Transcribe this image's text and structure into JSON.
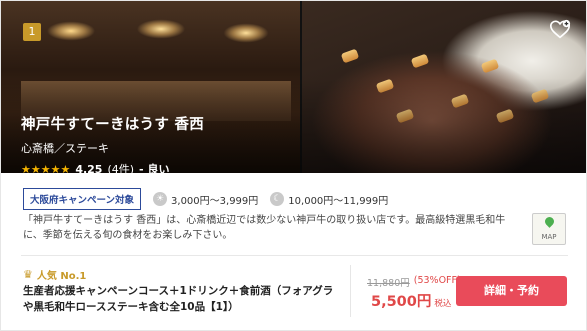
{
  "hero": {
    "rank_badge": "1",
    "shop_name": "神戸牛すてーきはうす 香西",
    "genre": "心斎橋／ステーキ",
    "stars": "★★★★★",
    "score": "4.25",
    "review_count": "(4件)",
    "rating_label": "- 良い",
    "favorite_icon": "heart-plus-icon"
  },
  "info": {
    "campaign_badge": "大阪府キャンペーン対象",
    "lunch_icon": "sun-icon",
    "lunch_price": "3,000円～3,999円",
    "dinner_icon": "moon-icon",
    "dinner_price": "10,000円～11,999円",
    "description": "「神戸牛すてーきはうす 香西」は、心斎橋近辺では数少ない神戸牛の取り扱い店です。最高級特選黒毛和牛に、季節を伝える旬の食材をお楽しみ下さい。",
    "map_label": "MAP"
  },
  "course": {
    "popular_label": "人気 No.1",
    "name": "生産者応援キャンペーンコース＋1ドリンク＋食前酒（フォアグラや黒毛和牛ロースステーキ含む全10品【1】）",
    "old_price": "11,880円",
    "discount": "(53%OFF)",
    "new_price": "5,500円",
    "tax": "税込",
    "reserve_label": "詳細・予約"
  },
  "colors": {
    "accent_red": "#e94b5a",
    "price_red": "#e04848",
    "gold": "#c89a2a",
    "campaign_blue": "#2c4a9a"
  }
}
